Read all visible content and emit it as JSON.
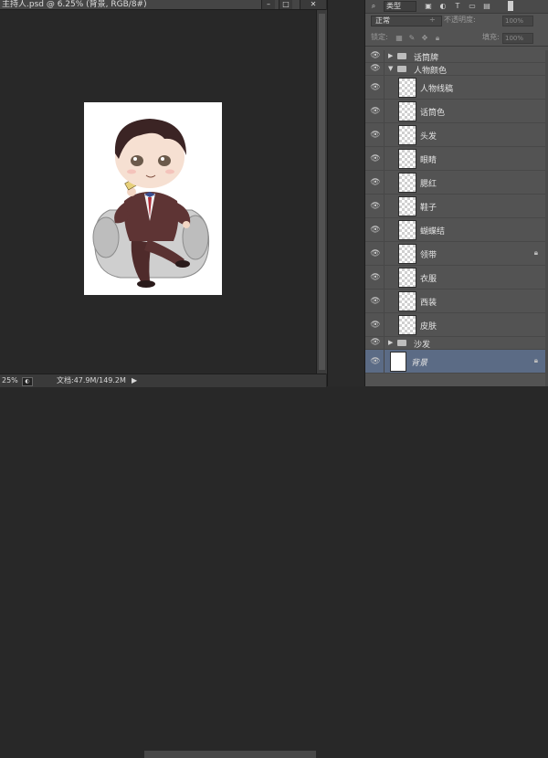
{
  "document": {
    "tab_title": "主持人.psd @ 6.25% (背景, RGB/8#)",
    "window_buttons": [
      "–",
      "□",
      "✕"
    ]
  },
  "status_bar": {
    "zoom": "25%",
    "doc_info": "文档:47.9M/149.2M",
    "arrow": "▶"
  },
  "layers_panel": {
    "filter_label": "类型",
    "blend_mode": "正常",
    "opacity_label": "不透明度:",
    "opacity_value": "100%",
    "lock_label": "锁定:",
    "fill_label": "填充:",
    "fill_value": "100%",
    "layers": [
      {
        "name": "话筒牌",
        "type": "group",
        "expanded": false,
        "indent": 0
      },
      {
        "name": "人物颜色",
        "type": "group",
        "expanded": true,
        "indent": 0
      },
      {
        "name": "人物线稿",
        "type": "layer",
        "indent": 1
      },
      {
        "name": "话筒色",
        "type": "layer",
        "indent": 1
      },
      {
        "name": "头发",
        "type": "layer",
        "indent": 1
      },
      {
        "name": "眼睛",
        "type": "layer",
        "indent": 1
      },
      {
        "name": "腮红",
        "type": "layer",
        "indent": 1
      },
      {
        "name": "鞋子",
        "type": "layer",
        "indent": 1
      },
      {
        "name": "蝴蝶结",
        "type": "layer",
        "indent": 1
      },
      {
        "name": "领带",
        "type": "layer",
        "indent": 1,
        "locked": true
      },
      {
        "name": "衣服",
        "type": "layer",
        "indent": 1
      },
      {
        "name": "西装",
        "type": "layer",
        "indent": 1
      },
      {
        "name": "皮肤",
        "type": "layer",
        "indent": 1
      },
      {
        "name": "沙发",
        "type": "group",
        "expanded": false,
        "indent": 0
      },
      {
        "name": "背景",
        "type": "layer",
        "indent": 0,
        "locked": true,
        "selected": true
      }
    ]
  },
  "colors": {
    "workspace": "#282828",
    "panel": "#535353",
    "selected_layer": "#5b6b85"
  }
}
